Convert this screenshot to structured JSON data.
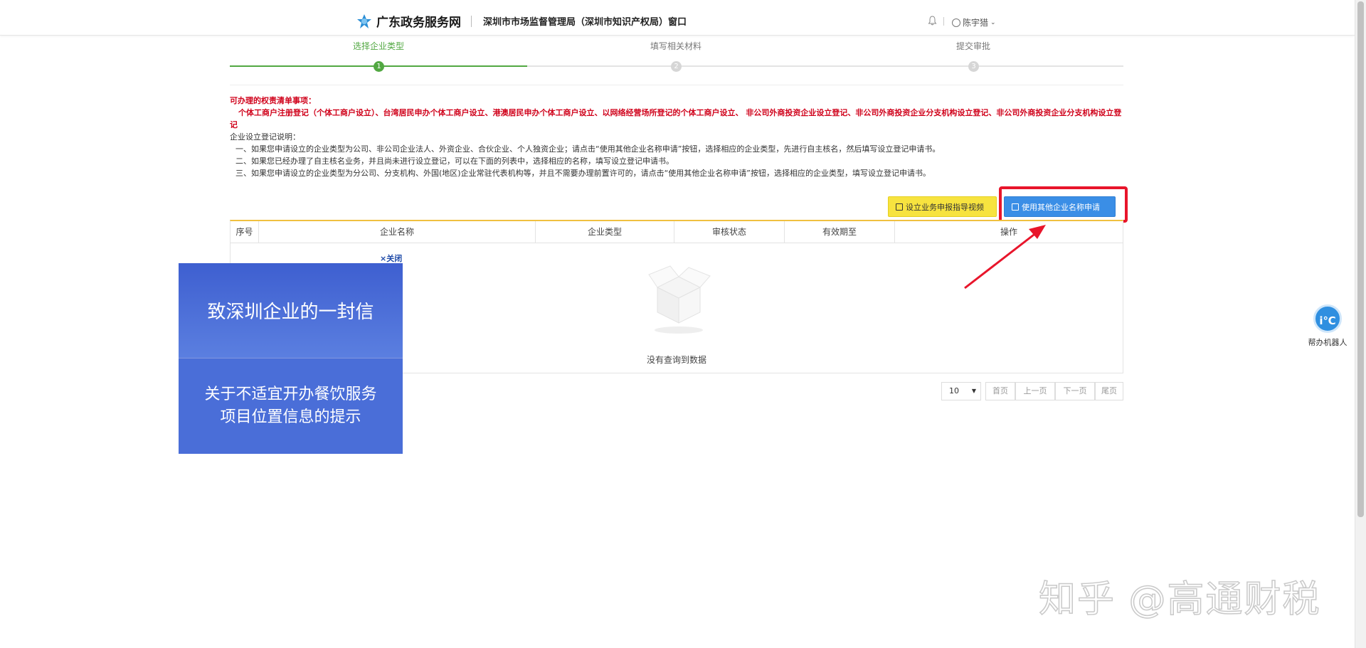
{
  "header": {
    "site_name": "广东政务服务网",
    "window_name": "深圳市市场监督管理局（深圳市知识产权局）窗口",
    "user_name": "陈宇猎"
  },
  "steps": [
    {
      "label": "选择企业类型",
      "number": "1",
      "active": true
    },
    {
      "label": "填写相关材料",
      "number": "2",
      "active": false
    },
    {
      "label": "提交审批",
      "number": "3",
      "active": false
    }
  ],
  "notice": {
    "heading": "可办理的权责清单事项：",
    "items_red": "个体工商户注册登记（个体工商户设立）、台湾居民申办个体工商户设立、港澳居民申办个体工商户设立、以网络经营场所登记的个体工商户设立、 非公司外商投资企业设立登记、非公司外商投资企业分支机构设立登记、非公司外商投资企业分支机构设立登记",
    "intro": "企业设立登记说明：",
    "line1": "一、如果您申请设立的企业类型为公司、非公司企业法人、外资企业、合伙企业、个人独资企业；请点击“使用其他企业名称申请”按钮，选择相应的企业类型，先进行自主核名，然后填写设立登记申请书。",
    "line2": "二、如果您已经办理了自主核名业务，并且尚未进行设立登记，可以在下面的列表中，选择相应的名称，填写设立登记申请书。",
    "line3": "三、如果您申请设立的企业类型为分公司、分支机构、外国(地区)企业常驻代表机构等，并且不需要办理前置许可的，请点击“使用其他企业名称申请”按钮，选择相应的企业类型，填写设立登记申请书。"
  },
  "buttons": {
    "guide_video": "设立业务申报指导视频",
    "other_name_apply": "使用其他企业名称申请"
  },
  "table": {
    "columns": [
      "序号",
      "企业名称",
      "企业类型",
      "审核状态",
      "有效期至",
      "操作"
    ],
    "rows": [],
    "empty_text": "没有查询到数据"
  },
  "pagination": {
    "page_size": "10",
    "first": "首页",
    "prev": "上一页",
    "next": "下一页",
    "last": "尾页"
  },
  "popup": {
    "close_label": "×关闭",
    "title": "致深圳企业的一封信",
    "subtitle": "关于不适宜开办餐饮服务项目位置信息的提示"
  },
  "robot": {
    "label": "帮办机器人"
  },
  "watermark": "知乎 @高通财税",
  "colors": {
    "accent_green": "#52a842",
    "notice_red": "#d0021b",
    "button_blue": "#3a8ee6",
    "button_yellow": "#f7e33f",
    "highlight_red": "#e8152b",
    "popup_blue": "#4a6ed8"
  }
}
